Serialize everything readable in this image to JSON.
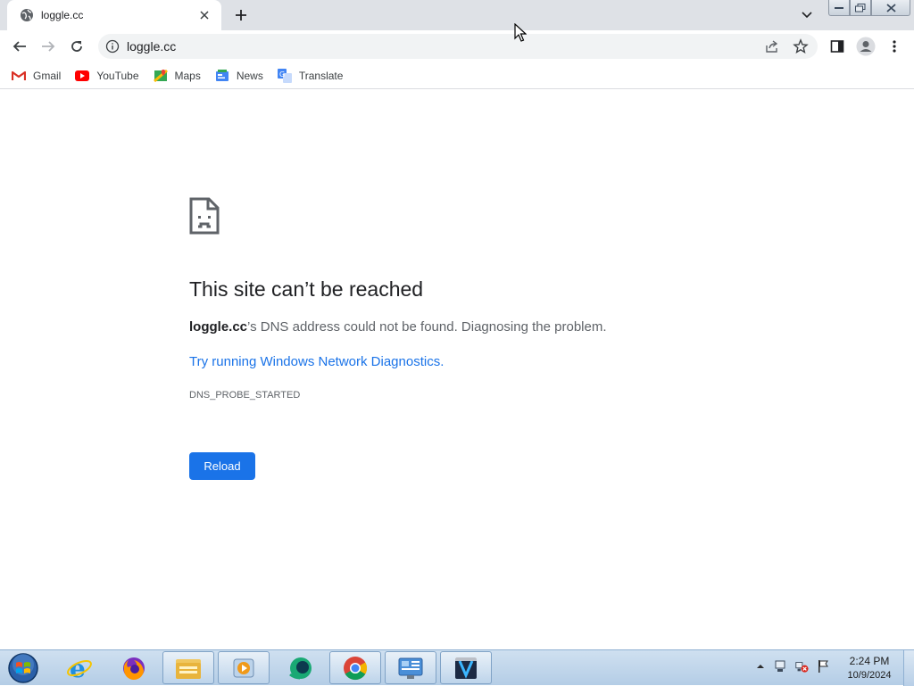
{
  "tab": {
    "title": "loggle.cc",
    "favicon": "globe-icon"
  },
  "toolbar": {
    "url": "loggle.cc"
  },
  "bookmarks": [
    {
      "label": "Gmail",
      "icon": "gmail-icon"
    },
    {
      "label": "YouTube",
      "icon": "youtube-icon"
    },
    {
      "label": "Maps",
      "icon": "maps-icon"
    },
    {
      "label": "News",
      "icon": "news-icon"
    },
    {
      "label": "Translate",
      "icon": "translate-icon"
    }
  ],
  "error": {
    "title": "This site can’t be reached",
    "domain": "loggle.cc",
    "description_rest": "’s DNS address could not be found. Diagnosing the problem.",
    "link": "Try running Windows Network Diagnostics.",
    "code": "DNS_PROBE_STARTED",
    "reload_label": "Reload"
  },
  "taskbar": {
    "apps": [
      "internet-explorer-icon",
      "firefox-icon",
      "file-explorer-icon",
      "media-player-icon",
      "green-app-icon",
      "chrome-icon",
      "control-panel-icon",
      "video-editor-icon"
    ],
    "time": "2:24 PM",
    "date": "10/9/2024"
  },
  "colors": {
    "accent": "#1a73e8",
    "tabstrip": "#dee1e6",
    "omnibox": "#f1f3f4"
  }
}
